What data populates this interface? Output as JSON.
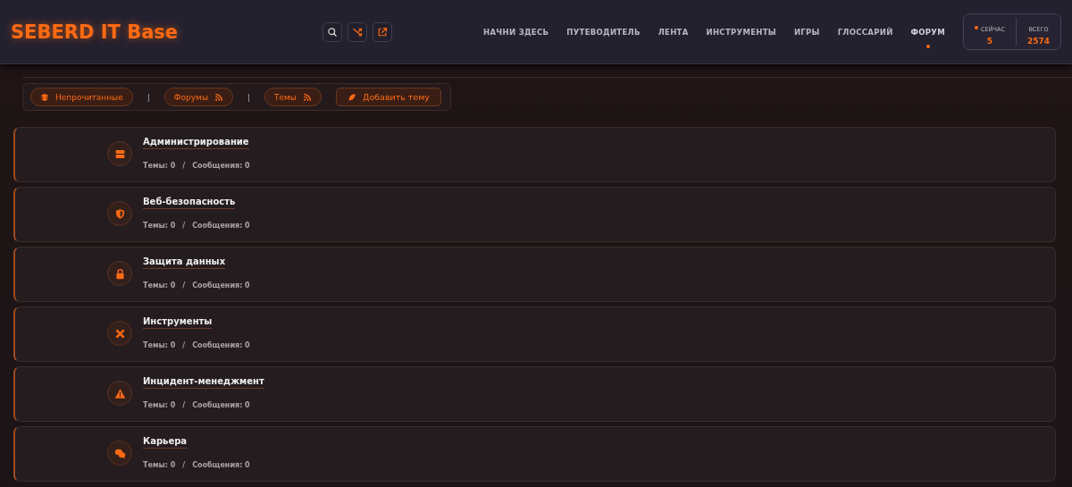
{
  "header": {
    "logo": "SEBERD IT Base",
    "nav": [
      {
        "label": "НАЧНИ ЗДЕСЬ",
        "selected": false
      },
      {
        "label": "ПУТЕВОДИТЕЛЬ",
        "selected": false
      },
      {
        "label": "ЛЕНТА",
        "selected": false
      },
      {
        "label": "ИНСТРУМЕНТЫ",
        "selected": false
      },
      {
        "label": "ИГРЫ",
        "selected": false
      },
      {
        "label": "ГЛОССАРИЙ",
        "selected": false
      },
      {
        "label": "ФОРУМ",
        "selected": true
      }
    ],
    "stats": [
      {
        "label": "СЕЙЧАС",
        "value": "5",
        "live": true
      },
      {
        "label": "ВСЕГО",
        "value": "2574",
        "live": false
      }
    ]
  },
  "toolbar": [
    {
      "kind": "pill",
      "label": "Непрочитанные"
    },
    {
      "kind": "separator",
      "label": "|"
    },
    {
      "kind": "feed",
      "label": "Форумы"
    },
    {
      "kind": "separator",
      "label": "|"
    },
    {
      "kind": "feed",
      "label": "Темы"
    },
    {
      "kind": "action",
      "label": "Добавить тему"
    }
  ],
  "forums": [
    {
      "title": "Администрирование",
      "topics": "Темы: 0",
      "sep": "/",
      "posts": "Сообщения: 0"
    },
    {
      "title": "Веб-безопасность",
      "topics": "Темы: 0",
      "sep": "/",
      "posts": "Сообщения: 0"
    },
    {
      "title": "Защита данных",
      "topics": "Темы: 0",
      "sep": "/",
      "posts": "Сообщения: 0"
    },
    {
      "title": "Инструменты",
      "topics": "Темы: 0",
      "sep": "/",
      "posts": "Сообщения: 0"
    },
    {
      "title": "Инцидент-менеджмент",
      "topics": "Темы: 0",
      "sep": "/",
      "posts": "Сообщения: 0"
    },
    {
      "title": "Карьера",
      "topics": "Темы: 0",
      "sep": "/",
      "posts": "Сообщения: 0"
    }
  ]
}
